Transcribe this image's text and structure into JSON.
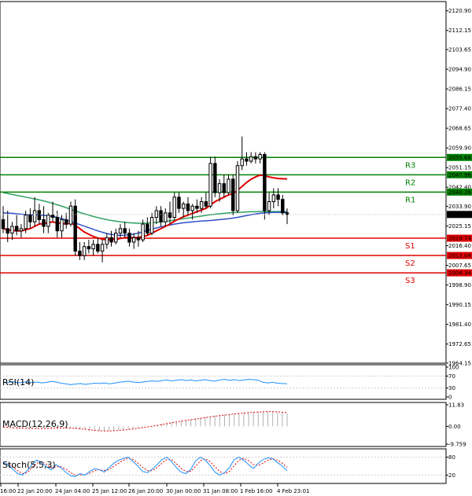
{
  "chart_data": [
    {
      "type": "candlestick",
      "ylim": [
        1964.15,
        2125.0
      ],
      "y_ticks": [
        2120.9,
        2112.15,
        2103.65,
        2094.9,
        2086.15,
        2077.4,
        2068.65,
        2059.9,
        2051.15,
        2042.4,
        2033.9,
        2025.15,
        2016.4,
        2007.65,
        1998.9,
        1990.15,
        1981.4,
        1972.65,
        1964.15
      ],
      "x_ticks": [
        "16:00",
        "22 Jan 20:00",
        "24 Jan 04:00",
        "25 Jan 12:00",
        "26 Jan 20:00",
        "30 Jan 00:00",
        "31 Jan 08:00",
        "1 Feb 16:00",
        "4 Feb 23:01"
      ],
      "current_price": "2030.26",
      "levels": [
        {
          "name": "R3",
          "value": 2055.66,
          "label": "2055.66",
          "color": "#008000"
        },
        {
          "name": "R2",
          "value": 2047.96,
          "label": "2047.96",
          "color": "#008000"
        },
        {
          "name": "R1",
          "value": 2040.26,
          "label": "2040.26",
          "color": "#008000"
        },
        {
          "name": "S1",
          "value": 2019.74,
          "label": "2019.74",
          "color": "#e00000"
        },
        {
          "name": "S2",
          "value": 2012.04,
          "label": "2012.04",
          "color": "#e00000"
        },
        {
          "name": "S3",
          "value": 2004.34,
          "label": "2004.34",
          "color": "#e00000"
        }
      ],
      "candles": [
        {
          "o": 2028.0,
          "h": 2034.0,
          "l": 2022.0,
          "c": 2024.0
        },
        {
          "o": 2024.0,
          "h": 2032.0,
          "l": 2018.0,
          "c": 2022.0
        },
        {
          "o": 2022.0,
          "h": 2027.0,
          "l": 2019.0,
          "c": 2025.0
        },
        {
          "o": 2025.0,
          "h": 2030.0,
          "l": 2021.0,
          "c": 2023.0
        },
        {
          "o": 2023.0,
          "h": 2026.0,
          "l": 2020.0,
          "c": 2024.0
        },
        {
          "o": 2024.0,
          "h": 2032.0,
          "l": 2022.0,
          "c": 2030.0
        },
        {
          "o": 2030.0,
          "h": 2033.0,
          "l": 2024.0,
          "c": 2027.0
        },
        {
          "o": 2027.0,
          "h": 2038.0,
          "l": 2025.0,
          "c": 2032.0
        },
        {
          "o": 2032.0,
          "h": 2035.0,
          "l": 2026.0,
          "c": 2028.0
        },
        {
          "o": 2028.0,
          "h": 2034.0,
          "l": 2022.0,
          "c": 2025.0
        },
        {
          "o": 2025.0,
          "h": 2031.0,
          "l": 2022.0,
          "c": 2030.0
        },
        {
          "o": 2030.0,
          "h": 2036.0,
          "l": 2027.0,
          "c": 2029.0
        },
        {
          "o": 2029.0,
          "h": 2032.0,
          "l": 2020.0,
          "c": 2023.0
        },
        {
          "o": 2023.0,
          "h": 2030.0,
          "l": 2020.0,
          "c": 2028.0
        },
        {
          "o": 2028.0,
          "h": 2031.0,
          "l": 2024.0,
          "c": 2026.0
        },
        {
          "o": 2026.0,
          "h": 2036.0,
          "l": 2025.0,
          "c": 2034.0
        },
        {
          "o": 2034.0,
          "h": 2037.0,
          "l": 2012.0,
          "c": 2014.0
        },
        {
          "o": 2014.0,
          "h": 2018.0,
          "l": 2010.0,
          "c": 2012.0
        },
        {
          "o": 2012.0,
          "h": 2018.0,
          "l": 2010.0,
          "c": 2016.0
        },
        {
          "o": 2016.0,
          "h": 2019.0,
          "l": 2013.0,
          "c": 2015.0
        },
        {
          "o": 2015.0,
          "h": 2019.0,
          "l": 2012.0,
          "c": 2017.0
        },
        {
          "o": 2017.0,
          "h": 2020.0,
          "l": 2013.0,
          "c": 2014.0
        },
        {
          "o": 2014.0,
          "h": 2019.0,
          "l": 2009.0,
          "c": 2017.0
        },
        {
          "o": 2017.0,
          "h": 2022.0,
          "l": 2015.0,
          "c": 2020.0
        },
        {
          "o": 2020.0,
          "h": 2023.0,
          "l": 2016.0,
          "c": 2018.0
        },
        {
          "o": 2018.0,
          "h": 2024.0,
          "l": 2017.0,
          "c": 2022.0
        },
        {
          "o": 2022.0,
          "h": 2026.0,
          "l": 2020.0,
          "c": 2024.0
        },
        {
          "o": 2024.0,
          "h": 2027.0,
          "l": 2020.0,
          "c": 2022.0
        },
        {
          "o": 2022.0,
          "h": 2024.0,
          "l": 2016.0,
          "c": 2018.0
        },
        {
          "o": 2018.0,
          "h": 2022.0,
          "l": 2015.0,
          "c": 2020.0
        },
        {
          "o": 2020.0,
          "h": 2023.0,
          "l": 2016.0,
          "c": 2019.0
        },
        {
          "o": 2019.0,
          "h": 2028.0,
          "l": 2018.0,
          "c": 2026.0
        },
        {
          "o": 2026.0,
          "h": 2029.0,
          "l": 2021.0,
          "c": 2022.0
        },
        {
          "o": 2022.0,
          "h": 2031.0,
          "l": 2021.0,
          "c": 2029.0
        },
        {
          "o": 2029.0,
          "h": 2034.0,
          "l": 2026.0,
          "c": 2032.0
        },
        {
          "o": 2032.0,
          "h": 2034.0,
          "l": 2025.0,
          "c": 2027.0
        },
        {
          "o": 2027.0,
          "h": 2033.0,
          "l": 2025.0,
          "c": 2031.0
        },
        {
          "o": 2031.0,
          "h": 2036.0,
          "l": 2026.0,
          "c": 2029.0
        },
        {
          "o": 2029.0,
          "h": 2040.0,
          "l": 2028.0,
          "c": 2038.0
        },
        {
          "o": 2038.0,
          "h": 2040.0,
          "l": 2031.0,
          "c": 2033.0
        },
        {
          "o": 2033.0,
          "h": 2036.0,
          "l": 2029.0,
          "c": 2035.0
        },
        {
          "o": 2035.0,
          "h": 2038.0,
          "l": 2030.0,
          "c": 2032.0
        },
        {
          "o": 2032.0,
          "h": 2035.0,
          "l": 2028.0,
          "c": 2034.0
        },
        {
          "o": 2034.0,
          "h": 2037.0,
          "l": 2031.0,
          "c": 2033.0
        },
        {
          "o": 2033.0,
          "h": 2038.0,
          "l": 2031.0,
          "c": 2036.0
        },
        {
          "o": 2036.0,
          "h": 2040.0,
          "l": 2033.0,
          "c": 2034.0
        },
        {
          "o": 2034.0,
          "h": 2056.0,
          "l": 2033.0,
          "c": 2053.0
        },
        {
          "o": 2053.0,
          "h": 2056.0,
          "l": 2038.0,
          "c": 2040.0
        },
        {
          "o": 2040.0,
          "h": 2046.0,
          "l": 2036.0,
          "c": 2044.0
        },
        {
          "o": 2044.0,
          "h": 2048.0,
          "l": 2038.0,
          "c": 2040.0
        },
        {
          "o": 2040.0,
          "h": 2048.0,
          "l": 2039.0,
          "c": 2046.0
        },
        {
          "o": 2046.0,
          "h": 2048.0,
          "l": 2030.0,
          "c": 2032.0
        },
        {
          "o": 2032.0,
          "h": 2054.0,
          "l": 2031.0,
          "c": 2052.0
        },
        {
          "o": 2052.0,
          "h": 2065.0,
          "l": 2050.0,
          "c": 2055.0
        },
        {
          "o": 2055.0,
          "h": 2058.0,
          "l": 2052.0,
          "c": 2054.0
        },
        {
          "o": 2054.0,
          "h": 2058.0,
          "l": 2053.0,
          "c": 2056.0
        },
        {
          "o": 2056.0,
          "h": 2058.0,
          "l": 2053.0,
          "c": 2055.0
        },
        {
          "o": 2055.0,
          "h": 2058.0,
          "l": 2053.0,
          "c": 2057.0
        },
        {
          "o": 2057.0,
          "h": 2058.0,
          "l": 2028.0,
          "c": 2032.0
        },
        {
          "o": 2032.0,
          "h": 2040.0,
          "l": 2030.0,
          "c": 2036.0
        },
        {
          "o": 2036.0,
          "h": 2042.0,
          "l": 2033.0,
          "c": 2039.0
        },
        {
          "o": 2039.0,
          "h": 2042.0,
          "l": 2034.0,
          "c": 2037.0
        },
        {
          "o": 2037.0,
          "h": 2039.0,
          "l": 2030.0,
          "c": 2031.0
        },
        {
          "o": 2031.0,
          "h": 2033.0,
          "l": 2026.0,
          "c": 2030.3
        }
      ],
      "ma_fast": [
        2024.0,
        2023.5,
        2023.2,
        2023.0,
        2023.0,
        2023.5,
        2024.0,
        2025.0,
        2026.0,
        2026.3,
        2026.6,
        2027.0,
        2026.5,
        2026.3,
        2026.0,
        2026.5,
        2025.5,
        2024.0,
        2022.5,
        2021.5,
        2020.5,
        2019.8,
        2019.3,
        2019.0,
        2019.0,
        2019.2,
        2019.6,
        2020.0,
        2020.0,
        2020.0,
        2020.0,
        2020.5,
        2021.0,
        2022.0,
        2023.0,
        2024.0,
        2025.0,
        2026.0,
        2027.3,
        2028.3,
        2029.3,
        2030.0,
        2030.8,
        2031.5,
        2032.3,
        2033.0,
        2034.5,
        2036.0,
        2037.0,
        2038.0,
        2039.0,
        2039.5,
        2041.0,
        2042.8,
        2044.5,
        2046.0,
        2047.0,
        2047.8,
        2047.5,
        2047.0,
        2046.6,
        2046.3,
        2046.2,
        2046.1
      ],
      "ma_mid": [
        2031.0,
        2030.9,
        2030.8,
        2030.6,
        2030.4,
        2030.3,
        2030.2,
        2030.2,
        2030.1,
        2029.9,
        2029.7,
        2029.5,
        2029.0,
        2028.4,
        2027.8,
        2027.2,
        2026.5,
        2025.8,
        2025.1,
        2024.4,
        2023.7,
        2023.0,
        2022.4,
        2021.8,
        2021.4,
        2021.1,
        2021.0,
        2021.1,
        2021.3,
        2021.6,
        2022.0,
        2022.6,
        2023.2,
        2023.8,
        2024.3,
        2024.8,
        2025.2,
        2025.6,
        2026.0,
        2026.3,
        2026.6,
        2026.8,
        2027.0,
        2027.2,
        2027.4,
        2027.5,
        2027.6,
        2027.8,
        2028.0,
        2028.2,
        2028.4,
        2028.7,
        2029.0,
        2029.4,
        2029.8,
        2030.2,
        2030.5,
        2030.8,
        2031.0,
        2031.1,
        2031.2,
        2031.2,
        2031.2,
        2031.2
      ],
      "ma_slow": [
        2040.0,
        2039.6,
        2039.2,
        2038.8,
        2038.4,
        2038.0,
        2037.6,
        2037.2,
        2036.8,
        2036.3,
        2035.8,
        2035.2,
        2034.6,
        2034.0,
        2033.3,
        2032.6,
        2031.9,
        2031.2,
        2030.6,
        2030.0,
        2029.4,
        2028.9,
        2028.4,
        2028.0,
        2027.6,
        2027.3,
        2027.0,
        2026.8,
        2026.6,
        2026.5,
        2026.4,
        2026.4,
        2026.5,
        2026.6,
        2026.8,
        2027.0,
        2027.2,
        2027.5,
        2027.8,
        2028.1,
        2028.4,
        2028.7,
        2029.0,
        2029.3,
        2029.6,
        2029.9,
        2030.2,
        2030.4,
        2030.6,
        2030.8,
        2031.0,
        2031.1,
        2031.2,
        2031.3,
        2031.4,
        2031.5,
        2031.5,
        2031.6,
        2031.6,
        2031.6,
        2031.6,
        2031.6,
        2031.6,
        2031.6
      ]
    },
    {
      "type": "line",
      "title": "RSI(14)",
      "ylim": [
        0,
        100
      ],
      "y_ticks": [
        100,
        70,
        30,
        0
      ],
      "series": [
        {
          "values": [
            49,
            48,
            52,
            47,
            49,
            51,
            48,
            50,
            47,
            49,
            52,
            50,
            46,
            44,
            41,
            43,
            45,
            42,
            44,
            46,
            45,
            47,
            44,
            46,
            49,
            51,
            53,
            50,
            48,
            50,
            52,
            54,
            52,
            55,
            57,
            54,
            56,
            58,
            55,
            57,
            54,
            56,
            58,
            55,
            53,
            57,
            59,
            56,
            58,
            55,
            57,
            59,
            58,
            56,
            49,
            47,
            49,
            46,
            45,
            44
          ]
        }
      ]
    },
    {
      "type": "bar",
      "title": "MACD(12,26,9)",
      "ylim": [
        -9.759,
        11.83
      ],
      "y_ticks": [
        "11.83",
        "0.00",
        "-9.759"
      ],
      "histogram": [
        -0.6,
        -0.8,
        -1.0,
        -1.1,
        -1.2,
        -1.3,
        -1.3,
        -1.3,
        -1.2,
        -1.1,
        -1.0,
        -0.9,
        -0.9,
        -1.0,
        -1.2,
        -1.4,
        -1.7,
        -2.0,
        -2.3,
        -2.5,
        -2.6,
        -2.6,
        -2.5,
        -2.3,
        -2.1,
        -1.8,
        -1.5,
        -1.2,
        -0.9,
        -0.5,
        -0.1,
        0.3,
        0.8,
        1.3,
        1.8,
        2.3,
        2.7,
        3.1,
        3.5,
        3.9,
        4.3,
        4.7,
        5.1,
        5.5,
        5.9,
        6.2,
        6.5,
        6.8,
        7.1,
        7.4,
        7.6,
        7.8,
        8.0,
        8.1,
        8.2,
        8.2,
        8.1,
        7.9,
        7.6,
        7.2
      ],
      "signal": [
        -0.4,
        -0.6,
        -0.8,
        -0.9,
        -1.0,
        -1.1,
        -1.2,
        -1.2,
        -1.2,
        -1.2,
        -1.1,
        -1.0,
        -0.9,
        -0.9,
        -1.0,
        -1.1,
        -1.3,
        -1.6,
        -1.9,
        -2.2,
        -2.4,
        -2.5,
        -2.5,
        -2.4,
        -2.2,
        -2.0,
        -1.7,
        -1.4,
        -1.1,
        -0.7,
        -0.3,
        0.1,
        0.5,
        1.0,
        1.5,
        2.0,
        2.4,
        2.8,
        3.2,
        3.6,
        4.0,
        4.4,
        4.8,
        5.2,
        5.6,
        5.9,
        6.2,
        6.5,
        6.8,
        7.1,
        7.3,
        7.5,
        7.7,
        7.9,
        8.0,
        8.1,
        8.1,
        8.0,
        7.8,
        7.5
      ]
    },
    {
      "type": "line",
      "title": "Stoch(5,5,3)",
      "ylim": [
        0,
        100
      ],
      "y_ticks": [
        80,
        20
      ],
      "series": [
        {
          "values": [
            62,
            55,
            40,
            25,
            20,
            35,
            55,
            70,
            62,
            48,
            38,
            55,
            45,
            30,
            18,
            15,
            25,
            20,
            32,
            42,
            38,
            30,
            45,
            60,
            70,
            76,
            80,
            65,
            50,
            32,
            28,
            40,
            55,
            72,
            80,
            65,
            45,
            30,
            25,
            40,
            68,
            80,
            70,
            52,
            30,
            20,
            28,
            45,
            72,
            80,
            70,
            55,
            42,
            60,
            72,
            78,
            75,
            62,
            50,
            35
          ]
        },
        {
          "values": [
            58,
            57,
            48,
            35,
            25,
            28,
            45,
            60,
            65,
            56,
            45,
            48,
            48,
            40,
            28,
            20,
            20,
            22,
            26,
            35,
            38,
            35,
            38,
            50,
            60,
            70,
            76,
            72,
            60,
            46,
            35,
            35,
            45,
            60,
            72,
            72,
            58,
            42,
            32,
            33,
            50,
            68,
            75,
            65,
            48,
            32,
            25,
            32,
            52,
            70,
            76,
            68,
            55,
            52,
            60,
            70,
            75,
            70,
            60,
            46
          ]
        }
      ]
    }
  ],
  "colors": {
    "candle_up": "#ffffff",
    "candle_down": "#000000",
    "ma_fast": "#e00000",
    "ma_mid": "#3050c8",
    "ma_slow": "#30a060",
    "price_tag": "#000000",
    "indicator_line": "#1e90ff",
    "stoch_signal": "#e00000",
    "macd_signal": "#e00000",
    "macd_hist": "#b0b0b0"
  }
}
